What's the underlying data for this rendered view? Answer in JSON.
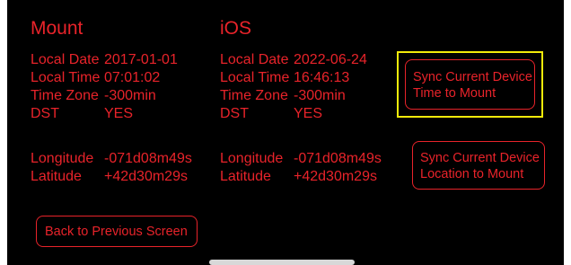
{
  "mount": {
    "heading": "Mount",
    "rows": [
      {
        "label": "Local Date",
        "value": "2017-01-01"
      },
      {
        "label": "Local Time",
        "value": "07:01:02"
      },
      {
        "label": "Time Zone",
        "value": "-300min"
      },
      {
        "label": "DST",
        "value": "YES"
      }
    ],
    "location": [
      {
        "label": "Longitude",
        "value": "-071d08m49s"
      },
      {
        "label": "Latitude",
        "value": "+42d30m29s"
      }
    ]
  },
  "ios": {
    "heading": "iOS",
    "rows": [
      {
        "label": "Local Date",
        "value": "2022-06-24"
      },
      {
        "label": "Local Time",
        "value": "16:46:13"
      },
      {
        "label": "Time Zone",
        "value": "-300min"
      },
      {
        "label": "DST",
        "value": "YES"
      }
    ],
    "location": [
      {
        "label": "Longitude",
        "value": "-071d08m49s"
      },
      {
        "label": "Latitude",
        "value": "+42d30m29s"
      }
    ]
  },
  "buttons": {
    "sync_time": "Sync Current Device\nTime to Mount",
    "sync_location": "Sync Current Device\nLocation to Mount",
    "back": "Back to Previous Screen"
  },
  "colors": {
    "background": "#000000",
    "text_accent": "#e8232a",
    "focus_highlight": "#f2ea0a"
  }
}
